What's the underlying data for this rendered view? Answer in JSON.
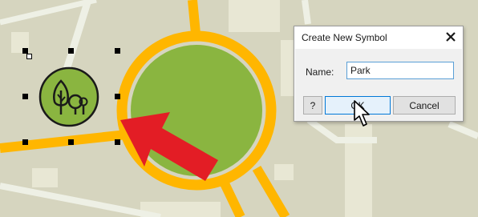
{
  "dialog": {
    "title": "Create New Symbol",
    "name_label": "Name:",
    "name_value": "Park",
    "help_button": "?",
    "ok_button": "OK",
    "cancel_button": "Cancel"
  },
  "icons": {
    "close": "close-icon",
    "symbol": "park-tree-icon",
    "cursor": "mouse-pointer-icon",
    "arrow": "red-arrow-icon"
  },
  "colors": {
    "map_background": "#d6d5bf",
    "road": "#eef0e5",
    "major_road": "#ffb600",
    "park_green": "#8ab540",
    "arrow_red": "#e31d25",
    "selected_accent": "#0078d7"
  }
}
